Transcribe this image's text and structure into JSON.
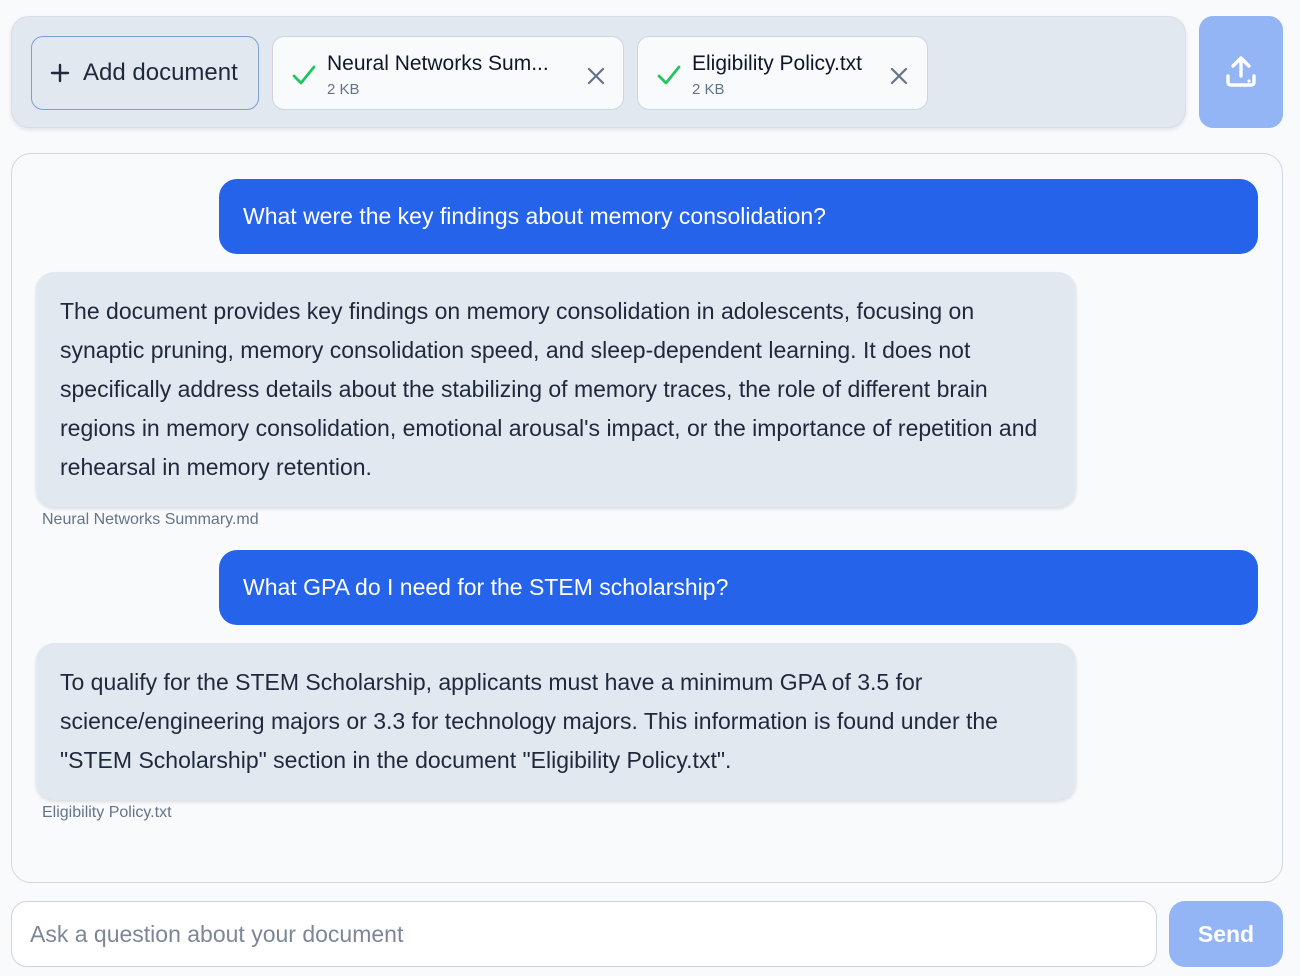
{
  "documents_bar": {
    "add_label": "Add document",
    "files": [
      {
        "name": "Neural Networks Sum...",
        "size": "2 KB",
        "status": "uploaded"
      },
      {
        "name": "Eligibility Policy.txt",
        "size": "2 KB",
        "status": "uploaded"
      }
    ],
    "icons": {
      "add": "plus-icon",
      "status": "check-icon",
      "remove": "close-icon",
      "upload": "upload-icon"
    }
  },
  "conversation": {
    "messages": [
      {
        "role": "user",
        "text": "What were the key findings about memory consolidation?"
      },
      {
        "role": "assistant",
        "text": "The document provides key findings on memory consolidation in adolescents, focusing on synaptic pruning, memory consolidation speed, and sleep-dependent learning. It does not specifically address details about the stabilizing of memory traces, the role of different brain regions in memory consolidation, emotional arousal's impact, or the importance of repetition and rehearsal in memory retention.",
        "source": "Neural Networks Summary.md"
      },
      {
        "role": "user",
        "text": "What GPA do I need for the STEM scholarship?"
      },
      {
        "role": "assistant",
        "text": "To qualify for the STEM Scholarship, applicants must have a minimum GPA of 3.5 for science/engineering majors or 3.3 for technology majors. This information is found under the \"STEM Scholarship\" section in the document \"Eligibility Policy.txt\".",
        "source": "Eligibility Policy.txt"
      }
    ]
  },
  "composer": {
    "placeholder": "Ask a question about your document",
    "value": "",
    "send_label": "Send"
  },
  "colors": {
    "primary": "#2563eb",
    "primary_disabled": "#93b4f5",
    "success": "#22c55e",
    "bot_bubble": "#e2e8f0",
    "muted_text": "#64748b"
  }
}
